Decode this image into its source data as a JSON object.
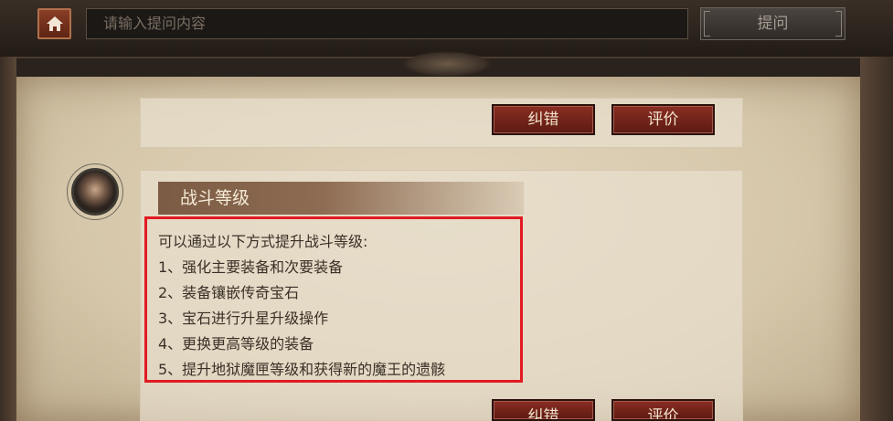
{
  "header": {
    "home_icon": "home-icon",
    "search_placeholder": "请输入提问内容",
    "ask_label": "提问"
  },
  "feedback_top": {
    "correct_label": "纠错",
    "rate_label": "评价"
  },
  "answer_card": {
    "title": "战斗等级",
    "lines": [
      "可以通过以下方式提升战斗等级:",
      "1、强化主要装备和次要装备",
      "2、装备镶嵌传奇宝石",
      "3、宝石进行升星升级操作",
      "4、更换更高等级的装备",
      "5、提升地狱魔匣等级和获得新的魔王的遗骸"
    ]
  },
  "feedback_bottom": {
    "correct_label": "纠错",
    "rate_label": "评价"
  },
  "colors": {
    "highlight_border": "#e21a22",
    "button_red": "#7a2419"
  }
}
